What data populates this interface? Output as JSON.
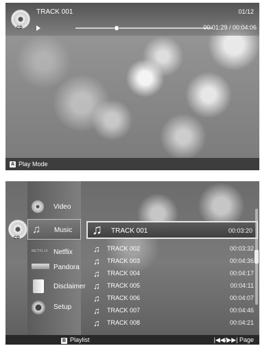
{
  "player": {
    "disc_label": "CD",
    "track_title": "TRACK 001",
    "track_count": "01/12",
    "progress_fraction": 0.3,
    "time_readout": "00:01:29 / 00:04:06",
    "play_mode_key": "A",
    "play_mode_label": "Play Mode"
  },
  "browser": {
    "disc_label": "CD",
    "menu": [
      {
        "label": "Video",
        "icon": "video-reel-icon"
      },
      {
        "label": "Music",
        "icon": "music-note-icon",
        "selected": true
      },
      {
        "label": "Netflix",
        "icon": "netflix-icon",
        "icon_text": "NETFLIX"
      },
      {
        "label": "Pandora",
        "icon": "pandora-icon"
      },
      {
        "label": "Disclaimer",
        "icon": "document-icon"
      },
      {
        "label": "Setup",
        "icon": "gear-icon"
      }
    ],
    "tracks": [
      {
        "name": "TRACK 001",
        "duration": "00:03:20",
        "selected": true
      },
      {
        "name": "TRACK 002",
        "duration": "00:03:32"
      },
      {
        "name": "TRACK 003",
        "duration": "00:04:36"
      },
      {
        "name": "TRACK 004",
        "duration": "00:04:17"
      },
      {
        "name": "TRACK 005",
        "duration": "00:04:11"
      },
      {
        "name": "TRACK 006",
        "duration": "00:04:07"
      },
      {
        "name": "TRACK 007",
        "duration": "00:04:46"
      },
      {
        "name": "TRACK 008",
        "duration": "00:04:21"
      }
    ],
    "playlist_key": "B",
    "playlist_label": "Playlist",
    "page_hint": "|◀◀/▶▶| Page"
  }
}
